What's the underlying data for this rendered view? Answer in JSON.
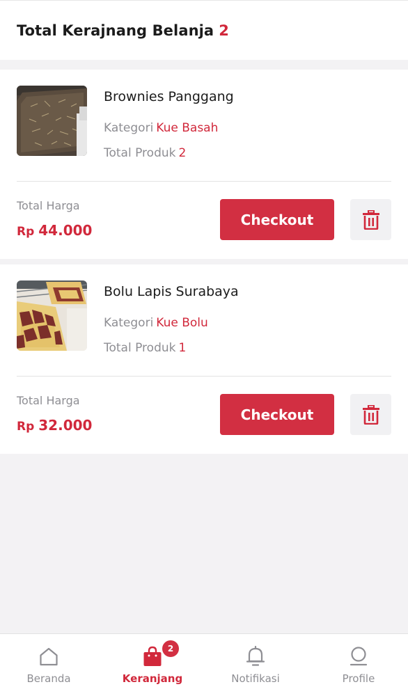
{
  "header": {
    "title": "Total Kerajnang Belanja",
    "count": "2"
  },
  "cart_items": [
    {
      "name": "Brownies Panggang",
      "category_label": "Kategori",
      "category": "Kue Basah",
      "quantity_label": "Total Produk",
      "quantity": "2",
      "total_label": "Total Harga",
      "currency": "Rp",
      "total_price": "44.000",
      "checkout_label": "Checkout",
      "image_icon": "brownies-photo"
    },
    {
      "name": "Bolu Lapis Surabaya",
      "category_label": "Kategori",
      "category": "Kue Bolu",
      "quantity_label": "Total Produk",
      "quantity": "1",
      "total_label": "Total Harga",
      "currency": "Rp",
      "total_price": "32.000",
      "checkout_label": "Checkout",
      "image_icon": "layer-cake-photo"
    }
  ],
  "bottom_nav": {
    "items": [
      {
        "label": "Beranda",
        "icon": "home-icon",
        "active": false
      },
      {
        "label": "Keranjang",
        "icon": "shopping-bag-icon",
        "active": true,
        "badge": "2"
      },
      {
        "label": "Notifikasi",
        "icon": "bell-icon",
        "active": false
      },
      {
        "label": "Profile",
        "icon": "profile-icon",
        "active": false
      }
    ]
  },
  "colors": {
    "accent": "#d1283b",
    "button": "#d22f42",
    "muted_text": "#8e8e93",
    "background": "#f3f2f4"
  }
}
